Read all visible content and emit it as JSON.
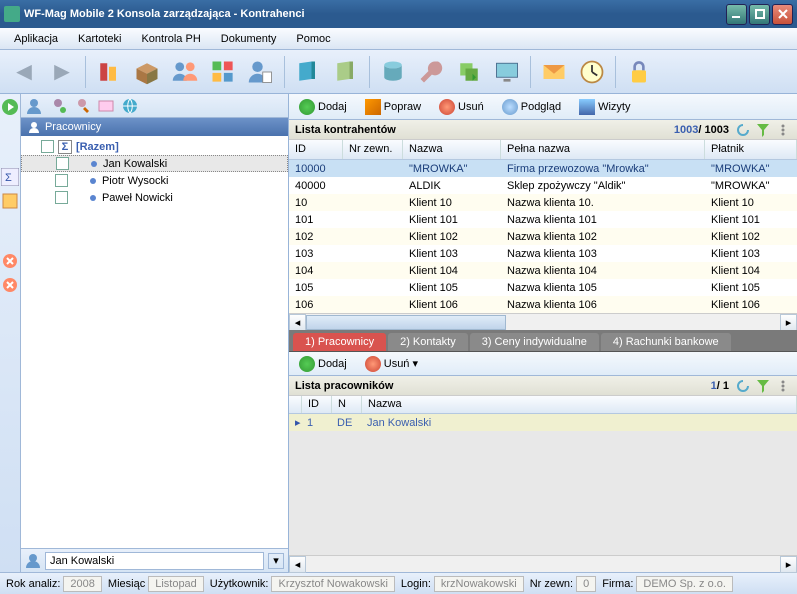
{
  "window": {
    "title": "WF-Mag Mobile 2 Konsola zarządzająca - Kontrahenci"
  },
  "menu": {
    "items": [
      "Aplikacja",
      "Kartoteki",
      "Kontrola PH",
      "Dokumenty",
      "Pomoc"
    ]
  },
  "sidebar": {
    "header": "Pracownicy",
    "razem": "[Razem]",
    "items": [
      "Jan Kowalski",
      "Piotr Wysocki",
      "Paweł Nowicki"
    ],
    "footer_value": "Jan Kowalski"
  },
  "actions": {
    "add": "Dodaj",
    "edit": "Popraw",
    "del": "Usuń",
    "view": "Podgląd",
    "visits": "Wizyty"
  },
  "list": {
    "title": "Lista kontrahentów",
    "count_a": "1003",
    "count_b": "/ 1003",
    "cols": [
      "ID",
      "Nr zewn.",
      "Nazwa",
      "Pełna nazwa",
      "Płatnik"
    ],
    "rows": [
      {
        "id": "10000",
        "ext": "",
        "name": "\"MROWKA\"",
        "full": "Firma przewozowa \"Mrowka\"",
        "payer": "\"MROWKA\""
      },
      {
        "id": "40000",
        "ext": "",
        "name": "ALDIK",
        "full": "Sklep zpożywczy \"Aldik\"",
        "payer": "\"MROWKA\""
      },
      {
        "id": "10",
        "ext": "",
        "name": "Klient 10",
        "full": "Nazwa klienta 10.",
        "payer": "Klient 10"
      },
      {
        "id": "101",
        "ext": "",
        "name": "Klient 101",
        "full": "Nazwa klienta 101",
        "payer": "Klient 101"
      },
      {
        "id": "102",
        "ext": "",
        "name": "Klient 102",
        "full": "Nazwa klienta 102",
        "payer": "Klient 102"
      },
      {
        "id": "103",
        "ext": "",
        "name": "Klient 103",
        "full": "Nazwa klienta 103",
        "payer": "Klient 103"
      },
      {
        "id": "104",
        "ext": "",
        "name": "Klient 104",
        "full": "Nazwa klienta 104",
        "payer": "Klient 104"
      },
      {
        "id": "105",
        "ext": "",
        "name": "Klient 105",
        "full": "Nazwa klienta 105",
        "payer": "Klient 105"
      },
      {
        "id": "106",
        "ext": "",
        "name": "Klient 106",
        "full": "Nazwa klienta 106",
        "payer": "Klient 106"
      }
    ]
  },
  "tabs": {
    "items": [
      "1) Pracownicy",
      "2) Kontakty",
      "3) Ceny indywidualne",
      "4) Rachunki bankowe"
    ]
  },
  "sub": {
    "actions": {
      "add": "Dodaj",
      "del": "Usuń"
    },
    "title": "Lista pracowników",
    "count_a": "1",
    "count_b": "/ 1",
    "cols": [
      "ID",
      "N",
      "Nazwa"
    ],
    "rows": [
      {
        "id": "1",
        "n": "DE",
        "name": "Jan Kowalski"
      }
    ]
  },
  "status": {
    "year_label": "Rok analiz:",
    "year": "2008",
    "month_label": "Miesiąc",
    "month": "Listopad",
    "user_label": "Użytkownik:",
    "user": "Krzysztof Nowakowski",
    "login_label": "Login:",
    "login": "krzNowakowski",
    "ext_label": "Nr zewn:",
    "ext": "0",
    "firm_label": "Firma:",
    "firm": "DEMO Sp. z o.o."
  }
}
